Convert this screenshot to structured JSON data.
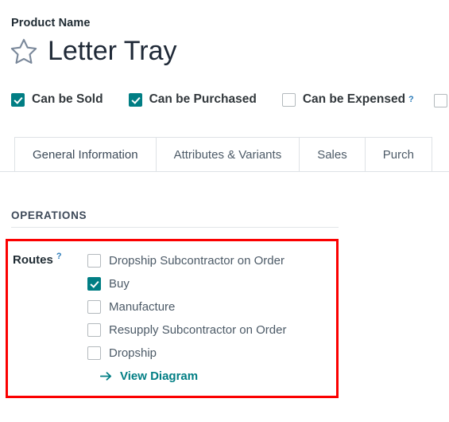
{
  "header": {
    "field_label": "Product Name",
    "title": "Letter Tray",
    "favorite_icon": "star-outline-icon"
  },
  "flags": [
    {
      "label": "Can be Sold",
      "checked": true,
      "help": null
    },
    {
      "label": "Can be Purchased",
      "checked": true,
      "help": null
    },
    {
      "label": "Can be Expensed",
      "checked": false,
      "help": "?"
    }
  ],
  "edge_checkbox": {
    "checked": false
  },
  "tabs": [
    {
      "label": "General Information",
      "active": true
    },
    {
      "label": "Attributes & Variants",
      "active": false
    },
    {
      "label": "Sales",
      "active": false
    },
    {
      "label": "Purch",
      "active": false
    }
  ],
  "operations": {
    "group_title": "OPERATIONS",
    "routes_label": "Routes",
    "routes_help": "?",
    "routes": [
      {
        "label": "Dropship Subcontractor on Order",
        "checked": false
      },
      {
        "label": "Buy",
        "checked": true
      },
      {
        "label": "Manufacture",
        "checked": false
      },
      {
        "label": "Resupply Subcontractor on Order",
        "checked": false
      },
      {
        "label": "Dropship",
        "checked": false
      }
    ],
    "view_diagram_label": "View Diagram",
    "view_diagram_icon": "arrow-right-icon"
  },
  "colors": {
    "accent_teal": "#017e84",
    "highlight_red": "#fb0000",
    "help_blue": "#2b7bb9",
    "text_dark": "#32383c",
    "text_muted": "#4c5a67",
    "border_gray": "#dee2e6"
  }
}
